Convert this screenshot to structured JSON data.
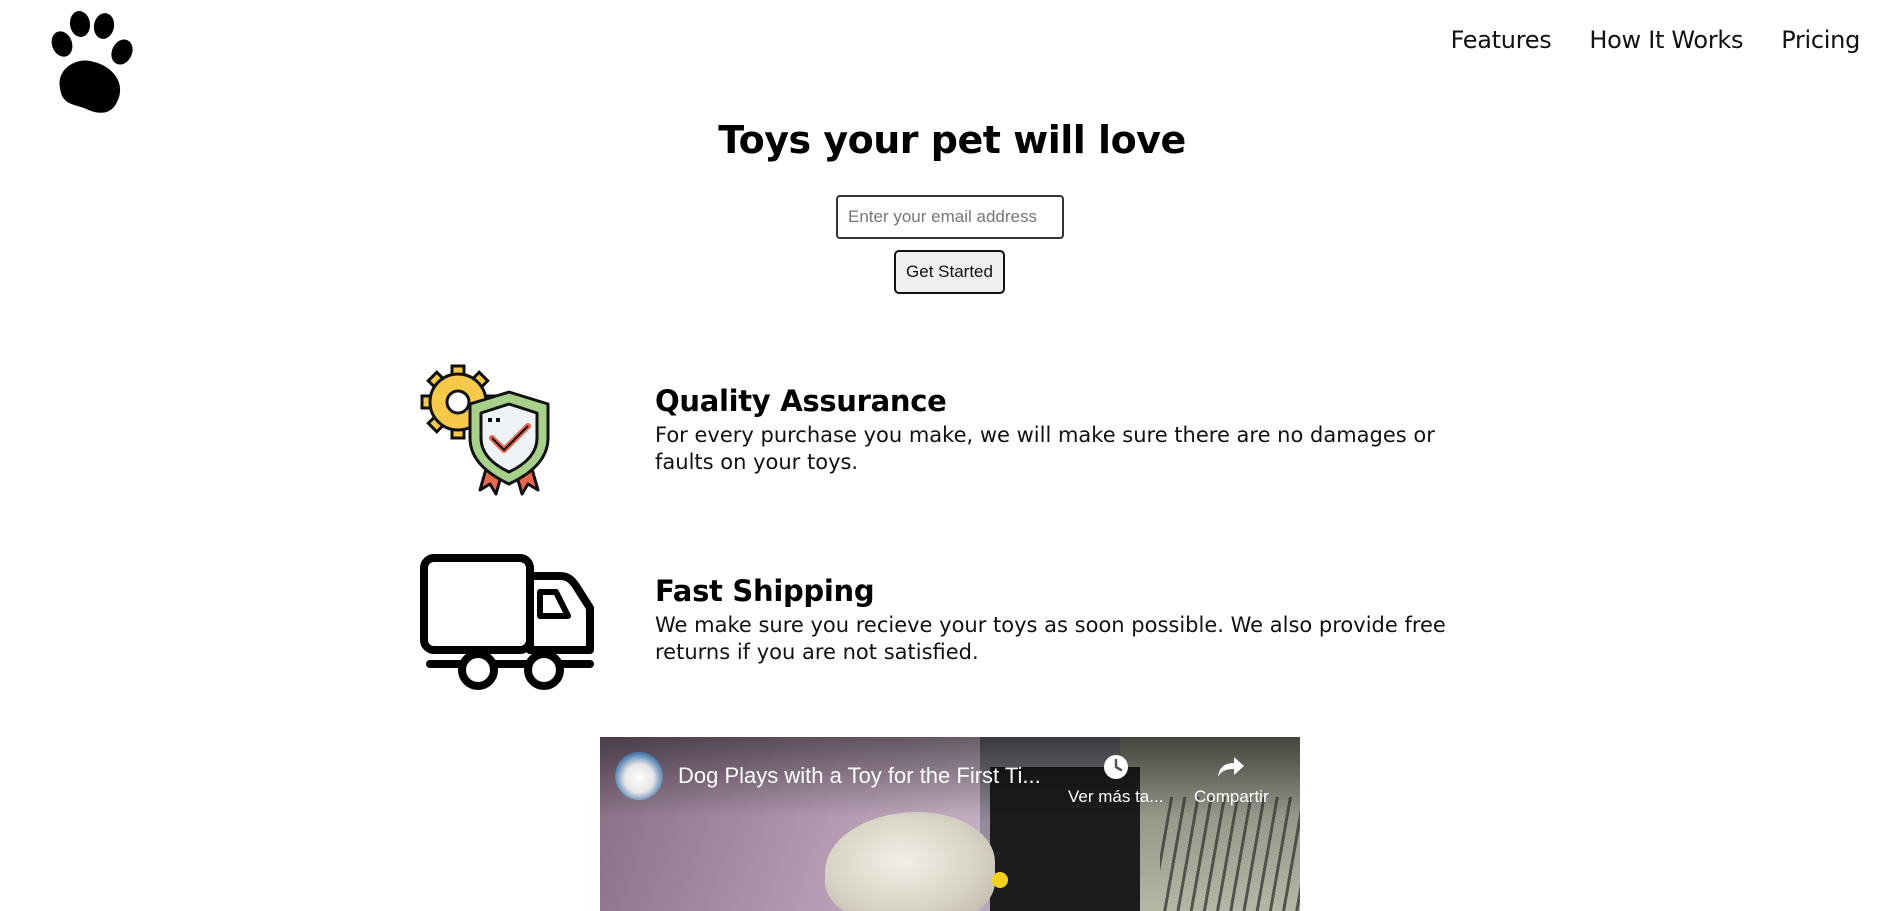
{
  "header": {
    "logo_icon": "paw-print-icon",
    "nav": [
      {
        "label": "Features"
      },
      {
        "label": "How It Works"
      },
      {
        "label": "Pricing"
      }
    ]
  },
  "hero": {
    "title": "Toys your pet will love",
    "email_placeholder": "Enter your email address",
    "email_value": "",
    "button_label": "Get Started"
  },
  "features": [
    {
      "icon": "quality-badge-icon",
      "title": "Quality Assurance",
      "description": "For every purchase you make, we will make sure there are no damages or faults on your toys."
    },
    {
      "icon": "truck-icon",
      "title": "Fast Shipping",
      "description": "We make sure you recieve your toys as soon possible. We also provide free returns if you are not satisfied."
    }
  ],
  "video": {
    "title": "Dog Plays with a Toy for the First Ti...",
    "watch_later_label": "Ver más ta...",
    "share_label": "Compartir",
    "watch_later_icon": "clock-icon",
    "share_icon": "share-arrow-icon"
  },
  "colors": {
    "text": "#000000",
    "background": "#ffffff",
    "gear_yellow": "#f6c94a",
    "shield_green": "#a7d08b",
    "ribbon_red": "#e8684f"
  }
}
